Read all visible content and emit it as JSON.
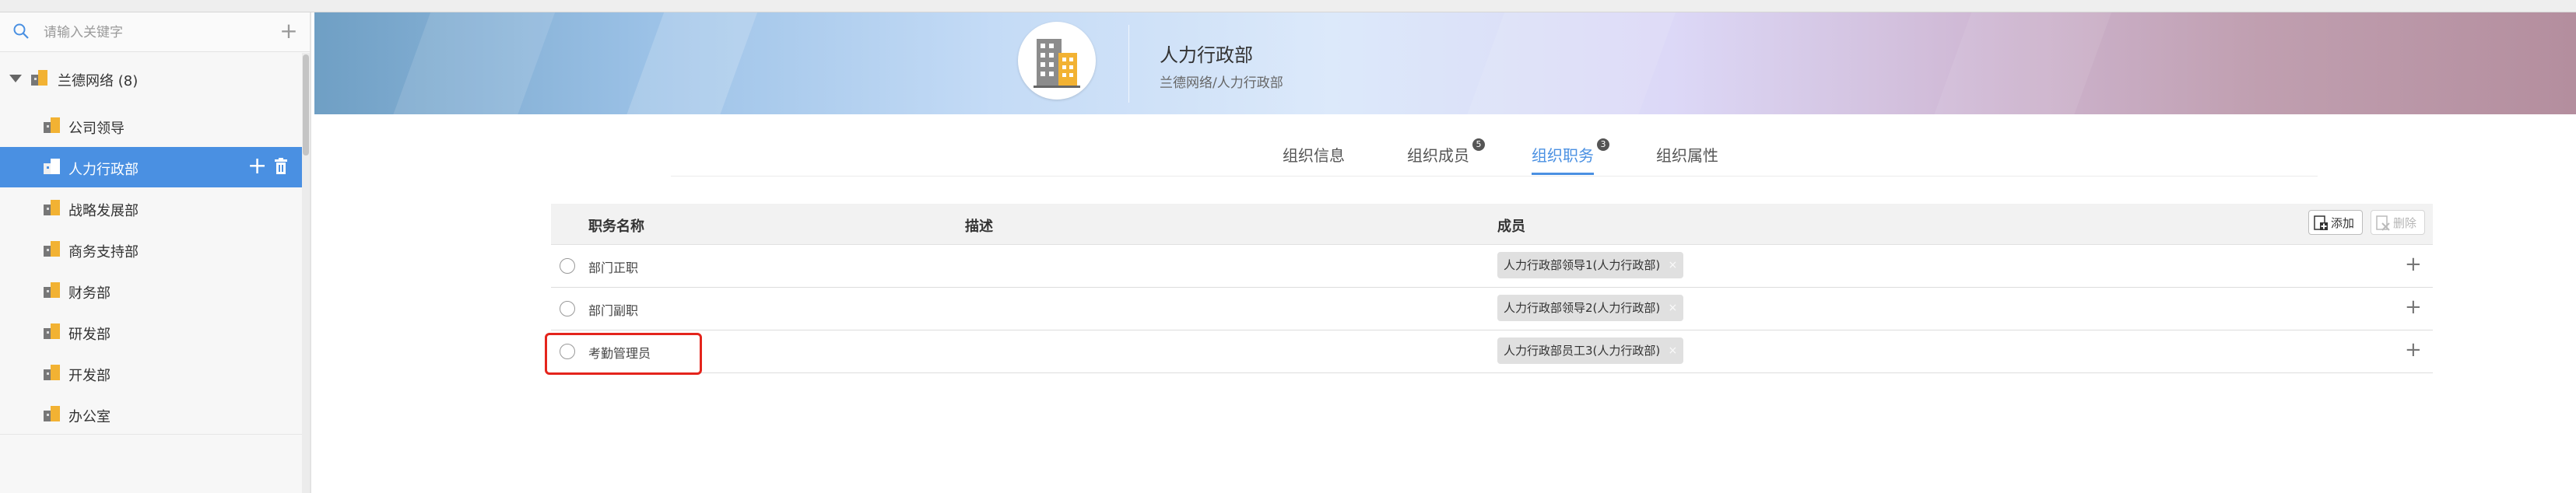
{
  "sidebar": {
    "search_placeholder": "请输入关键字",
    "add_symbol": "+",
    "root": {
      "label": "兰德网络 (8)"
    },
    "items": [
      {
        "label": "公司领导"
      },
      {
        "label": "人力行政部",
        "selected": true
      },
      {
        "label": "战略发展部"
      },
      {
        "label": "商务支持部"
      },
      {
        "label": "财务部"
      },
      {
        "label": "研发部"
      },
      {
        "label": "开发部"
      },
      {
        "label": "办公室"
      }
    ],
    "item_add_symbol": "+"
  },
  "header": {
    "title": "人力行政部",
    "path": "兰德网络/人力行政部"
  },
  "tabs": [
    {
      "label": "组织信息"
    },
    {
      "label": "组织成员",
      "badge": "5"
    },
    {
      "label": "组织职务",
      "badge": "3",
      "active": true
    },
    {
      "label": "组织属性"
    }
  ],
  "table": {
    "columns": {
      "name": "职务名称",
      "desc": "描述",
      "members": "成员"
    },
    "add_button": "添加",
    "delete_button": "删除",
    "rows": [
      {
        "name": "部门正职",
        "description": "",
        "member": "人力行政部领导1(人力行政部)"
      },
      {
        "name": "部门副职",
        "description": "",
        "member": "人力行政部领导2(人力行政部)"
      },
      {
        "name": "考勤管理员",
        "description": "",
        "member": "人力行政部员工3(人力行政部)"
      }
    ],
    "tag_close_symbol": "×",
    "row_add_symbol": "+"
  },
  "colors": {
    "accent": "#4a90e2",
    "highlight": "#e4241c",
    "building_orange": "#f2b233"
  }
}
